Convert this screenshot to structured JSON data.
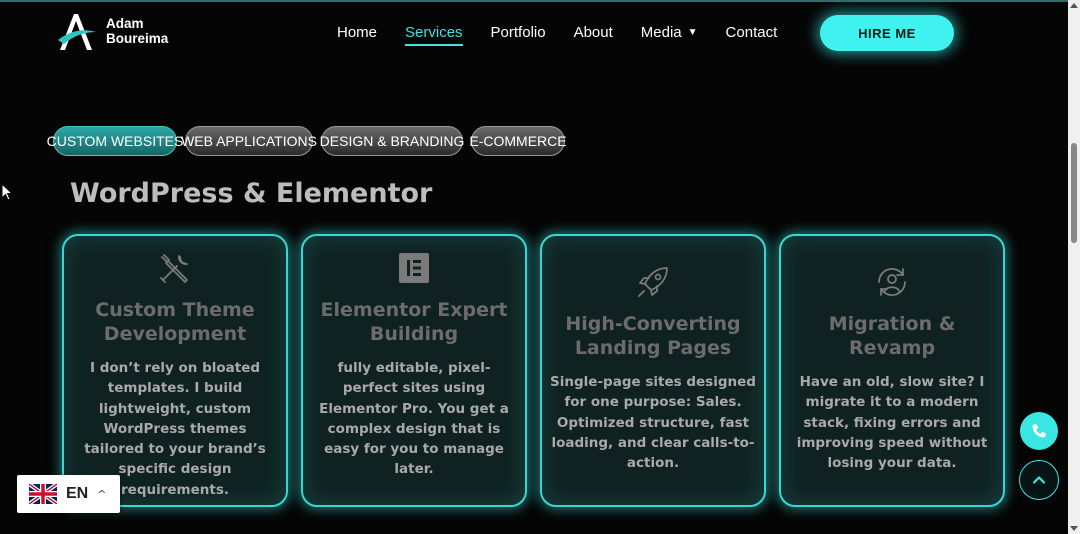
{
  "header": {
    "logo": {
      "line1": "Adam",
      "line2": "Boureima"
    },
    "nav": [
      {
        "label": "Home"
      },
      {
        "label": "Services",
        "active": true
      },
      {
        "label": "Portfolio"
      },
      {
        "label": "About"
      },
      {
        "label": "Media",
        "has_dropdown": true
      },
      {
        "label": "Contact"
      }
    ],
    "hire_button": "HIRE ME"
  },
  "tabs": [
    {
      "label": "CUSTOM WEBSITES",
      "active": true
    },
    {
      "label": "WEB APPLICATIONS"
    },
    {
      "label": "DESIGN & BRANDING"
    },
    {
      "label": "E-COMMERCE"
    }
  ],
  "section": {
    "title": "WordPress & Elementor",
    "cards": [
      {
        "icon": "tools-icon",
        "title": "Custom Theme Development",
        "desc": "I don’t rely on bloated templates. I build lightweight, custom WordPress themes tailored to your brand’s specific design requirements."
      },
      {
        "icon": "elementor-icon",
        "title": "Elementor Expert Building",
        "desc": "fully editable, pixel-perfect sites using Elementor Pro. You get a complex design that is easy for you to manage later."
      },
      {
        "icon": "rocket-icon",
        "title": "High-Converting Landing Pages",
        "desc": "Single-page sites designed for one purpose: Sales. Optimized structure, fast loading, and clear calls-to-action."
      },
      {
        "icon": "user-sync-icon",
        "title": "Migration & Revamp",
        "desc": "Have an old, slow site? I migrate it to a modern stack, fixing errors and improving speed without losing your data."
      }
    ]
  },
  "language": {
    "code": "EN",
    "flag": "uk-flag-icon"
  },
  "colors": {
    "accent": "#3ff2ef",
    "card_border": "#38d7d3",
    "background": "#050505"
  }
}
